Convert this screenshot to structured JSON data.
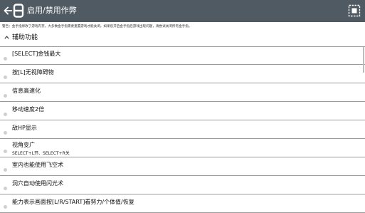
{
  "appbar": {
    "title": "启用/禁用作弊",
    "logo_glyph": "8",
    "background": "#4f5a63",
    "back_icon": "arrow-left-icon",
    "select_icon": "select-all-icon"
  },
  "warning": "警告：金手指修改了游戏内存。大多数金手指需要重置游戏才能关闭。如果您开启金手指后游戏出现问题，请尝试关闭所有金手指。",
  "category": {
    "label": "辅助功能",
    "icon": "chevron-up-icon"
  },
  "cheats": [
    {
      "label": "[SELECT]金钱最大",
      "sub": ""
    },
    {
      "label": "按[L]无视障碍物",
      "sub": ""
    },
    {
      "label": "信息高速化",
      "sub": ""
    },
    {
      "label": "移动速度2倍",
      "sub": ""
    },
    {
      "label": "敌HP显示",
      "sub": ""
    },
    {
      "label": "视角变广",
      "sub": "SELECT+L开、SELECT+R关"
    },
    {
      "label": "室内也能使用飞空术",
      "sub": ""
    },
    {
      "label": "洞穴自动使用闪光术",
      "sub": ""
    },
    {
      "label": "能力表示画面按[L/R/START]看努力/个体值/恢复",
      "sub": ""
    }
  ]
}
